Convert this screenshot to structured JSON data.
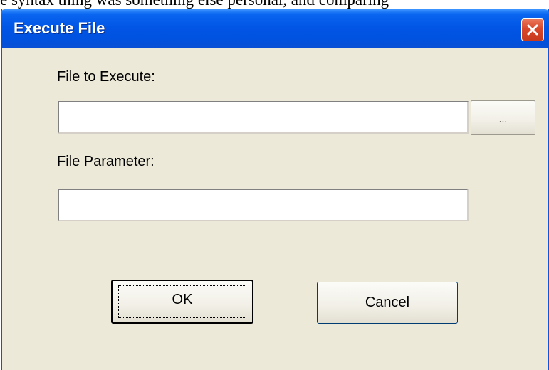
{
  "background": {
    "text": "e syntax thing was something else personal, and comparing"
  },
  "dialog": {
    "title": "Execute File",
    "close_icon": "close-x-icon",
    "file_to_execute_label": "File to Execute:",
    "file_to_execute_value": "",
    "browse_label": "...",
    "file_parameter_label": "File Parameter:",
    "file_parameter_value": "",
    "ok_label": "OK",
    "cancel_label": "Cancel"
  },
  "colors": {
    "titlebar": "#0256e6",
    "dialog_background": "#ece9d8",
    "close_button": "#d9472a"
  }
}
